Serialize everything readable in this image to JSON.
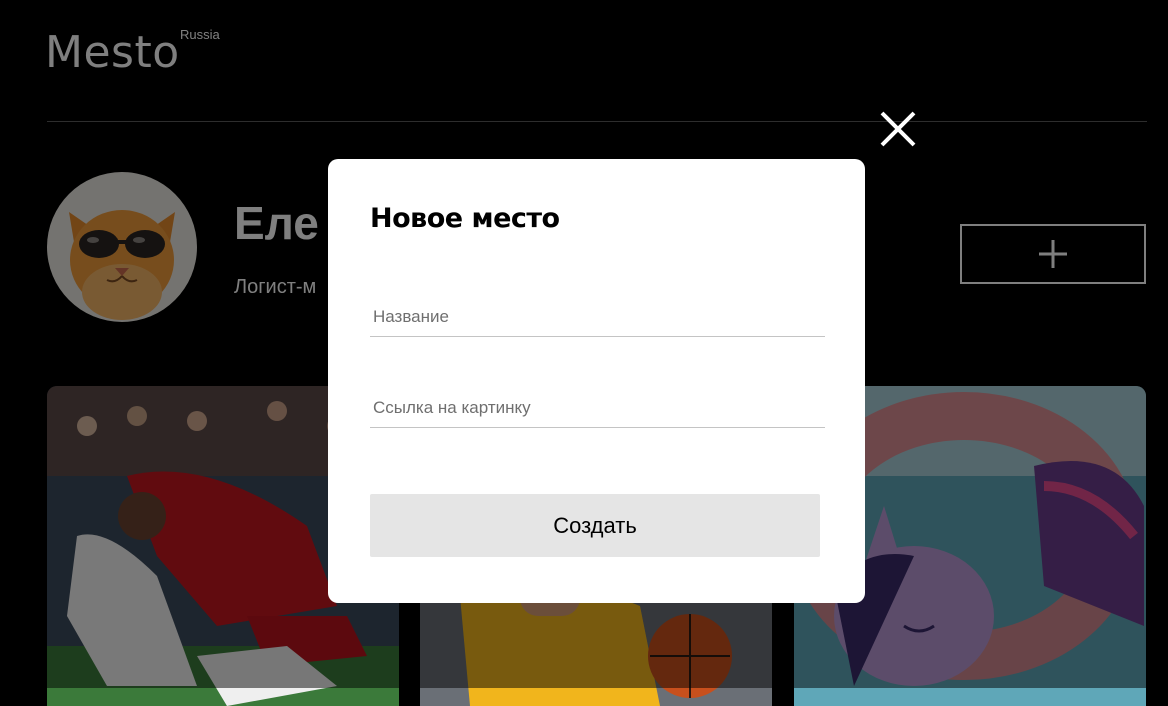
{
  "header": {
    "logo": "Mesto",
    "logo_superscript": "Russia"
  },
  "profile": {
    "name": "Еле",
    "job": "Логист-м"
  },
  "popup": {
    "title": "Новое место",
    "name_field": {
      "placeholder": "Название",
      "value": ""
    },
    "link_field": {
      "placeholder": "Ссылка на картинку",
      "value": ""
    },
    "submit_label": "Создать"
  },
  "cards": [
    {
      "subject": "football-match-photo"
    },
    {
      "subject": "basketball-photo"
    },
    {
      "subject": "pony-illustration"
    }
  ],
  "colors": {
    "page_background": "#000000",
    "overlay": "rgba(0,0,0,0.5)",
    "popup_background": "#ffffff",
    "submit_background": "#e5e5e5"
  }
}
